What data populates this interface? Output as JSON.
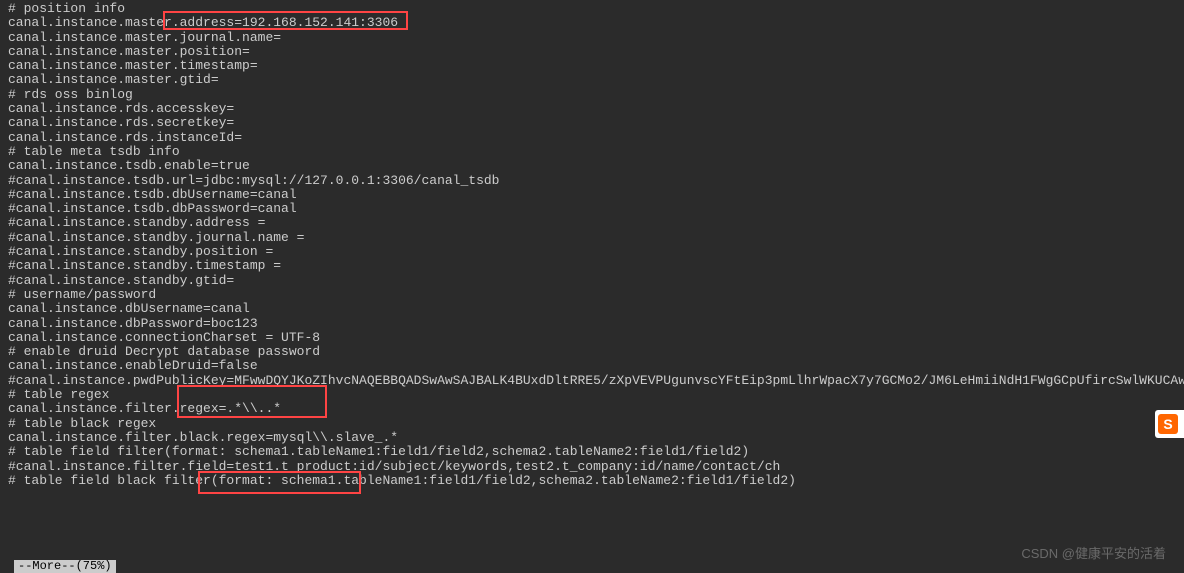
{
  "lines": [
    "# position info",
    "canal.instance.master.address=192.168.152.141:3306",
    "canal.instance.master.journal.name=",
    "canal.instance.master.position=",
    "canal.instance.master.timestamp=",
    "canal.instance.master.gtid=",
    "",
    "# rds oss binlog",
    "canal.instance.rds.accesskey=",
    "canal.instance.rds.secretkey=",
    "canal.instance.rds.instanceId=",
    "",
    "# table meta tsdb info",
    "canal.instance.tsdb.enable=true",
    "#canal.instance.tsdb.url=jdbc:mysql://127.0.0.1:3306/canal_tsdb",
    "#canal.instance.tsdb.dbUsername=canal",
    "#canal.instance.tsdb.dbPassword=canal",
    "",
    "#canal.instance.standby.address =",
    "#canal.instance.standby.journal.name =",
    "#canal.instance.standby.position =",
    "#canal.instance.standby.timestamp =",
    "#canal.instance.standby.gtid=",
    "",
    "# username/password",
    "canal.instance.dbUsername=canal",
    "canal.instance.dbPassword=boc123",
    "canal.instance.connectionCharset = UTF-8",
    "# enable druid Decrypt database password",
    "canal.instance.enableDruid=false",
    "#canal.instance.pwdPublicKey=MFwwDQYJKoZIhvcNAQEBBQADSwAwSAJBALK4BUxdDltRRE5/zXpVEVPUgunvscYFtEip3pmLlhrWpacX7y7GCMo2/JM6LeHmiiNdH1FWgGCpUfircSwlWKUCAwEAAQ==",
    "",
    "# table regex",
    "canal.instance.filter.regex=.*\\\\..*",
    "# table black regex",
    "canal.instance.filter.black.regex=mysql\\\\.slave_.*",
    "# table field filter(format: schema1.tableName1:field1/field2,schema2.tableName2:field1/field2)",
    "#canal.instance.filter.field=test1.t_product:id/subject/keywords,test2.t_company:id/name/contact/ch",
    "# table field black filter(format: schema1.tableName1:field1/field2,schema2.tableName2:field1/field2)"
  ],
  "statusBar": "--More--(75%)",
  "watermark": "CSDN @健康平安的活着",
  "badge": "S"
}
